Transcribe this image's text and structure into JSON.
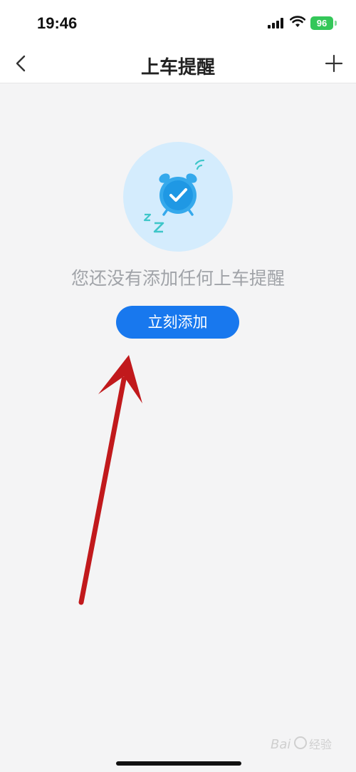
{
  "status_bar": {
    "time": "19:46",
    "battery_level": "96",
    "icons": [
      "signal-icon",
      "wifi-icon",
      "battery-icon"
    ]
  },
  "nav": {
    "title": "上车提醒",
    "back_icon": "chevron-left-icon",
    "add_icon": "plus-icon"
  },
  "empty_state": {
    "illustration": "alarm-clock-check-icon",
    "message": "您还没有添加任何上车提醒",
    "button_label": "立刻添加"
  },
  "colors": {
    "accent": "#1878ee",
    "illustration_bg": "#d4ecfd",
    "annotation_arrow": "#c1191c",
    "battery": "#34c759"
  }
}
